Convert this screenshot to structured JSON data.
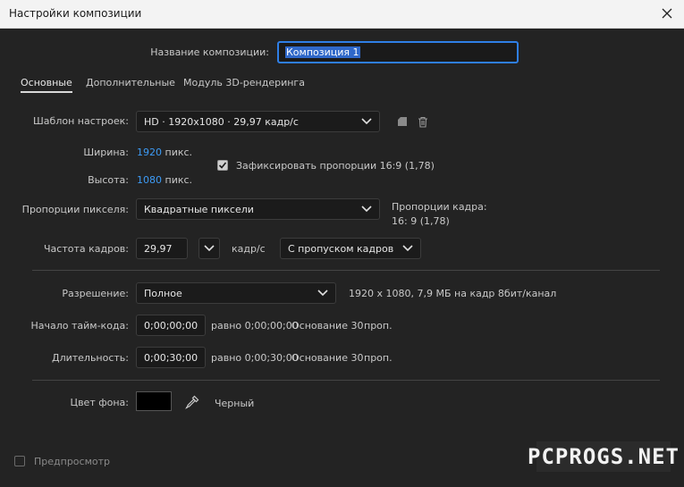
{
  "window": {
    "title": "Настройки композиции"
  },
  "comp_name": {
    "label": "Название композиции:",
    "value": "Композиция 1"
  },
  "tabs": [
    {
      "label": "Основные",
      "active": true
    },
    {
      "label": "Дополнительные",
      "active": false
    },
    {
      "label": "Модуль 3D-рендеринга",
      "active": false
    }
  ],
  "preset": {
    "label": "Шаблон настроек:",
    "value": "HD  ·  1920x1080 · 29,97 кадр/с"
  },
  "width": {
    "label": "Ширина:",
    "value": "1920",
    "unit": "пикс."
  },
  "height": {
    "label": "Высота:",
    "value": "1080",
    "unit": "пикс."
  },
  "lock_aspect": {
    "label": "Зафиксировать пропорции 16:9 (1,78)",
    "checked": true
  },
  "pixel_aspect": {
    "label": "Пропорции пикселя:",
    "value": "Квадратные пиксели"
  },
  "frame_aspect": {
    "label": "Пропорции кадра:",
    "value": "16: 9 (1,78)"
  },
  "frame_rate": {
    "label": "Частота кадров:",
    "value": "29,97",
    "unit": "кадр/с",
    "mode": "С пропуском кадров"
  },
  "resolution": {
    "label": "Разрешение:",
    "value": "Полное",
    "info": "1920 x 1080, 7,9 МБ на кадр 8бит/канал"
  },
  "timecode_start": {
    "label": "Начало тайм-кода:",
    "value": "0;00;00;00",
    "equals": "равно 0;00;00;00",
    "base": "Основание 30",
    "unit": "проп."
  },
  "duration": {
    "label": "Длительность:",
    "value": "0;00;30;00",
    "equals": "равно 0;00;30;00",
    "base": "Основание 30",
    "unit": "проп."
  },
  "background": {
    "label": "Цвет фона:",
    "name": "Черный",
    "color": "#000000"
  },
  "preview": {
    "label": "Предпросмотр",
    "checked": false
  },
  "watermark": {
    "text": "PCPROGS.NET"
  },
  "colors": {
    "accent": "#3d9bf5",
    "focus": "#2f7fe6",
    "bg": "#232323"
  }
}
